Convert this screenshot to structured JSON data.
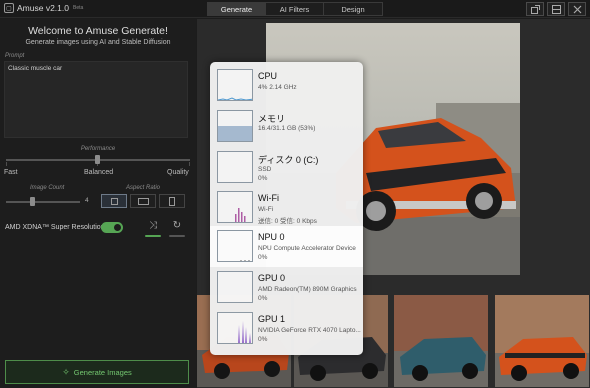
{
  "titlebar": {
    "app_name": "Amuse v2.1.0",
    "app_badge": "Beta",
    "tabs": [
      "Generate",
      "AI Filters",
      "Design"
    ],
    "active_tab": "Generate",
    "window_buttons": [
      "popout-icon",
      "window-icon",
      "close-icon"
    ]
  },
  "panel": {
    "welcome": "Welcome to Amuse Generate!",
    "subtitle": "Generate images using AI and Stable Diffusion",
    "prompt_label": "Prompt",
    "prompt_value": "Classic muscle car",
    "performance_label": "Performance",
    "performance_ticks": [
      "Fast",
      "Balanced",
      "Quality"
    ],
    "performance_value": "Balanced",
    "image_count_label": "Image Count",
    "image_count_value": "4",
    "aspect_ratio_label": "Aspect Ratio",
    "aspect_ratio_options": [
      "square",
      "landscape",
      "portrait"
    ],
    "aspect_ratio_selected": "square",
    "super_resolution_label": "AMD XDNA™ Super Resolution",
    "super_resolution_on": true,
    "generate_button": "Generate Images"
  },
  "popup": {
    "items": [
      {
        "name": "CPU",
        "desc": "4% 2.14 GHz",
        "value": ""
      },
      {
        "name": "メモリ",
        "desc": "16.4/31.1 GB (53%)",
        "value": ""
      },
      {
        "name": "ディスク 0 (C:)",
        "desc": "SSD",
        "value": "0%"
      },
      {
        "name": "Wi-Fi",
        "desc": "Wi-Fi",
        "value": "送信: 0 受信: 0 Kbps"
      },
      {
        "name": "NPU 0",
        "desc": "NPU Compute Accelerator Device",
        "value": "0%"
      },
      {
        "name": "GPU 0",
        "desc": "AMD Radeon(TM) 890M Graphics",
        "value": "0%"
      },
      {
        "name": "GPU 1",
        "desc": "NVIDIA GeForce RTX 4070 Lapto...",
        "value": "0%"
      }
    ],
    "selected": "NPU 0"
  },
  "colors": {
    "accent_green": "#56a554",
    "car_orange": "#d4521c",
    "graph_cpu": "#4f9bd3",
    "graph_gpu": "#7c4ac4"
  }
}
